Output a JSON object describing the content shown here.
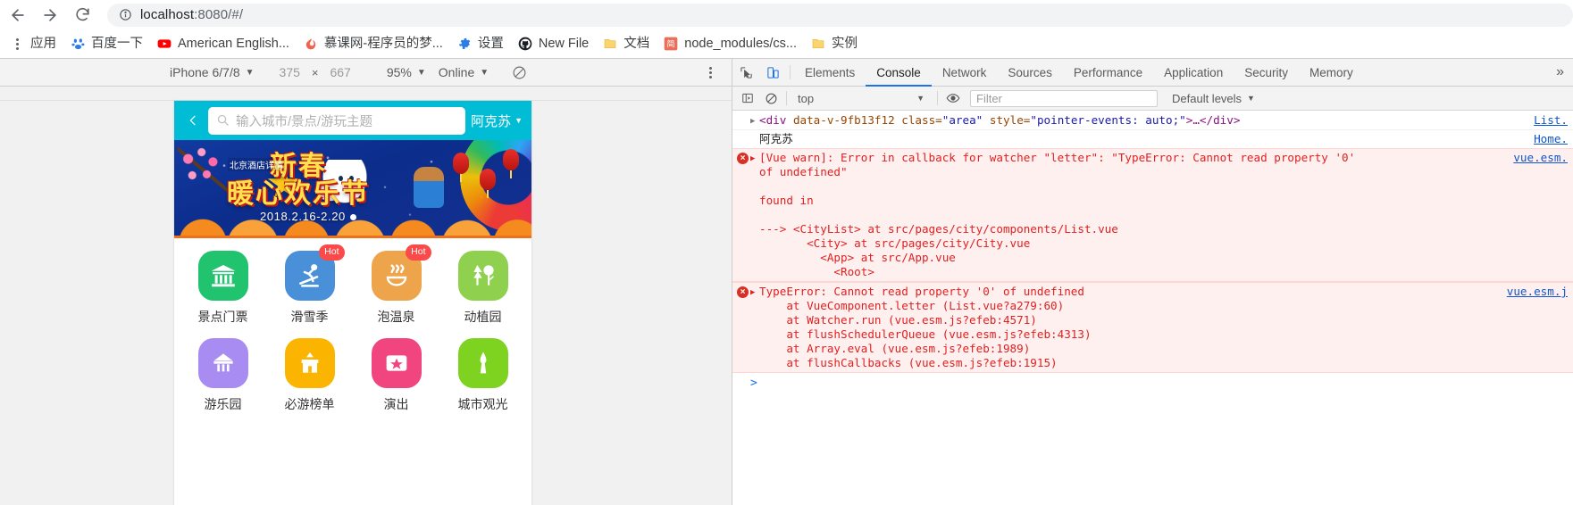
{
  "browser": {
    "nav": {
      "back_icon": "arrow-left-icon",
      "forward_icon": "arrow-right-icon",
      "reload_icon": "reload-icon",
      "info_icon": "page-info-icon",
      "url_host": "localhost",
      "url_path": ":8080/#/"
    },
    "bookmarks": [
      {
        "label": "应用",
        "icon": "apps-grid-icon"
      },
      {
        "label": "百度一下",
        "icon": "baidu-icon"
      },
      {
        "label": "American English...",
        "icon": "youtube-icon"
      },
      {
        "label": "慕课网-程序员的梦...",
        "icon": "flame-icon"
      },
      {
        "label": "设置",
        "icon": "gear-icon"
      },
      {
        "label": "New File",
        "icon": "github-icon"
      },
      {
        "label": "文档",
        "icon": "folder-icon"
      },
      {
        "label": "node_modules/cs...",
        "icon": "jianshu-icon"
      },
      {
        "label": "实例",
        "icon": "folder-icon"
      }
    ]
  },
  "device_toolbar": {
    "device": "iPhone 6/7/8",
    "width": "375",
    "x_symbol": "×",
    "height": "667",
    "zoom": "95%",
    "network": "Online",
    "throttle_icon": "no-throttling-icon",
    "kebab_icon": "more-options-icon"
  },
  "phone": {
    "header": {
      "back_icon": "chevron-left-icon",
      "search_icon": "search-icon",
      "search_placeholder": "输入城市/景点/游玩主题",
      "search_value": "",
      "city": "阿克苏",
      "city_caret": "▼"
    },
    "banner": {
      "title": "新春\n暖心欢乐节",
      "title_line1": "新春",
      "title_line2": "暖心欢乐节",
      "subtitle": "北京酒店详情",
      "date_range": "2018.2.16-2.20"
    },
    "icon_grid": [
      {
        "label": "景点门票",
        "icon": "temple-icon",
        "color": "#21c36f",
        "badge": ""
      },
      {
        "label": "滑雪季",
        "icon": "skier-icon",
        "color": "#4a90d9",
        "badge": "Hot"
      },
      {
        "label": "泡温泉",
        "icon": "hot-spring-icon",
        "color": "#efa košek",
        "badge": "Hot"
      },
      {
        "label": "动植园",
        "icon": "park-icon",
        "color": "#8fd14f",
        "badge": ""
      },
      {
        "label": "游乐园",
        "icon": "ferris-wheel-icon",
        "color": "#a98cf2",
        "badge": ""
      },
      {
        "label": "必游榜单",
        "icon": "castle-icon",
        "color": "#fbb500",
        "badge": ""
      },
      {
        "label": "演出",
        "icon": "star-ticket-icon",
        "color": "#f0457f",
        "badge": ""
      },
      {
        "label": "城市观光",
        "icon": "tower-icon",
        "color": "#7ed321",
        "badge": ""
      }
    ]
  },
  "devtools": {
    "inspect_icon": "inspect-element-icon",
    "device_toggle_icon": "toggle-device-toolbar-icon",
    "tabs": [
      "Elements",
      "Console",
      "Network",
      "Sources",
      "Performance",
      "Application",
      "Security",
      "Memory"
    ],
    "selected_tab": "Console",
    "more_tabs_icon": "chevron-right-icon",
    "console_toolbar": {
      "sidebar_icon": "console-sidebar-icon",
      "clear_icon": "clear-console-icon",
      "context": "top",
      "context_caret": "▼",
      "eye_icon": "live-expression-icon",
      "filter_placeholder": "Filter",
      "filter_value": "",
      "levels": "Default levels",
      "levels_caret": "▼"
    },
    "console_rows": [
      {
        "type": "dom",
        "disclosure": "▶",
        "html_tag": "<div",
        "attr1_name": "data-v-9fb13f12",
        "attr2_name": "class=",
        "attr2_value": "\"area\"",
        "attr3_name": "style=",
        "attr3_value": "\"pointer-events: auto;\"",
        "tail": ">…</div>",
        "link": "List."
      },
      {
        "type": "plain",
        "text": "阿克苏",
        "link": "Home."
      },
      {
        "type": "error",
        "disclosure": "▶",
        "lines": [
          "[Vue warn]: Error in callback for watcher \"letter\": \"TypeError: Cannot read property '0'",
          "of undefined\"",
          "",
          "found in",
          "",
          "---> <CityList> at src/pages/city/components/List.vue",
          "       <City> at src/pages/city/City.vue",
          "         <App> at src/App.vue",
          "           <Root>"
        ],
        "link": "vue.esm."
      },
      {
        "type": "error",
        "disclosure": "▶",
        "lines": [
          "TypeError: Cannot read property '0' of undefined",
          "    at VueComponent.letter (List.vue?a279:60)",
          "    at Watcher.run (vue.esm.js?efeb:4571)",
          "    at flushSchedulerQueue (vue.esm.js?efeb:4313)",
          "    at Array.eval (vue.esm.js?efeb:1989)",
          "    at flushCallbacks (vue.esm.js?efeb:1915)"
        ],
        "link": "vue.esm.j"
      }
    ],
    "prompt": ">"
  }
}
